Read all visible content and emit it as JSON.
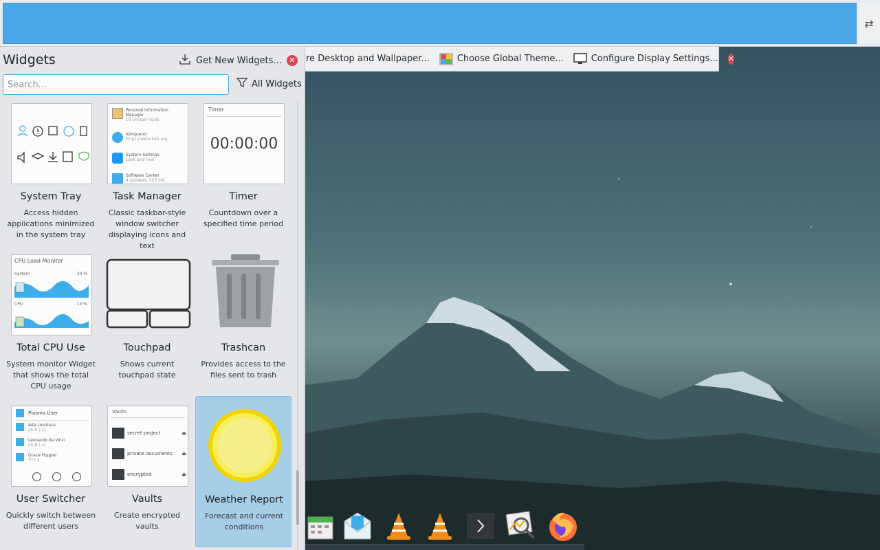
{
  "widgets_panel": {
    "title": "Widgets",
    "get_new_label": "Get New Widgets...",
    "search_placeholder": "Search...",
    "filter_label": "All Widgets",
    "items": [
      {
        "name": "System Tray",
        "description": "Access hidden applications minimized in the system tray"
      },
      {
        "name": "Task Manager",
        "description": "Classic taskbar-style window switcher displaying icons and text"
      },
      {
        "name": "Timer",
        "description": "Countdown over a specified time period"
      },
      {
        "name": "Total CPU Use",
        "description": "System monitor Widget that shows the total CPU usage"
      },
      {
        "name": "Touchpad",
        "description": "Shows current touchpad state"
      },
      {
        "name": "Trashcan",
        "description": "Provides access to the files sent to trash"
      },
      {
        "name": "User Switcher",
        "description": "Quickly switch between different users"
      },
      {
        "name": "Vaults",
        "description": "Create encrypted vaults"
      },
      {
        "name": "Weather Report",
        "description": "Forecast and current conditions",
        "selected": true
      }
    ],
    "previews": {
      "task_manager": [
        {
          "title": "Personal Information Manager",
          "sub": "10 unread mails"
        },
        {
          "title": "Konqueror",
          "sub": "https://www.kde.org"
        },
        {
          "title": "System Settings",
          "sub": "Look and Feel"
        },
        {
          "title": "Software Center",
          "sub": "4 updates, 125 mb"
        }
      ],
      "timer": {
        "header": "Timer",
        "value": "00:00:00"
      },
      "cpu": {
        "header": "CPU Load Monitor",
        "row1_label": "System",
        "row1_value": "30 %",
        "row2_label": "CPU",
        "row2_value": "10 %"
      },
      "user_switcher": {
        "header": "Plasma User",
        "users": [
          {
            "name": "Ada Lovelace",
            "sub": "on 6 (:1)"
          },
          {
            "name": "Leonardo da Vinci",
            "sub": "on 8 (:1)"
          },
          {
            "name": "Grace Hopper",
            "sub": "TTY 3"
          }
        ]
      },
      "vaults": {
        "header": "Vaults",
        "items": [
          "secret project",
          "private documents",
          "encrypted"
        ]
      }
    }
  },
  "edit_toolbar": {
    "items": [
      {
        "label": "re Desktop and Wallpaper..."
      },
      {
        "label": "Choose Global Theme..."
      },
      {
        "label": "Configure Display Settings..."
      }
    ]
  },
  "icons": {
    "get_new": "download-icon",
    "close": "close-icon",
    "filter": "filter-icon",
    "panel_config": "configure-icon",
    "dock": [
      "calendar-icon",
      "mail-icon",
      "vlc-icon",
      "vlc-icon",
      "terminal-icon",
      "image-viewer-icon",
      "firefox-icon"
    ]
  },
  "colors": {
    "accent": "#3daee9",
    "panel_edit": "#4aa8e8",
    "close": "#da4453",
    "weather_sun": "#f6ee5a"
  }
}
